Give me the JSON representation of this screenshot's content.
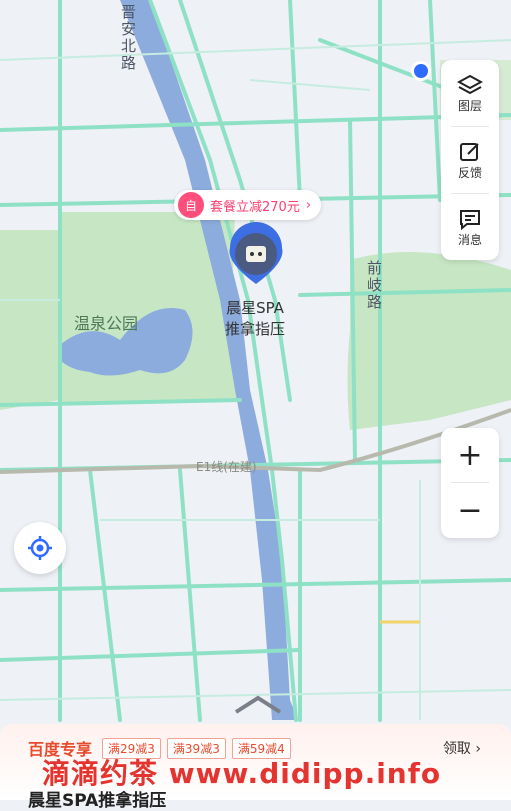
{
  "map": {
    "roads": {
      "jinan_north": "晋安北路",
      "qianqi": "前岐路",
      "metro": "E1线(在建)"
    },
    "park_label": "温泉公园",
    "poi": {
      "name_line1": "晨星SPA",
      "name_line2": "推拿指压"
    },
    "promo": {
      "icon_text": "自",
      "text": "套餐立减270元",
      "chevron": "›"
    },
    "colors": {
      "road": "#8fe1c5",
      "park": "#c7e7c4",
      "water": "#8cacdd",
      "promo": "#ff3d6e",
      "location_dot": "#2f6bff"
    }
  },
  "controls": {
    "layers_label": "图层",
    "feedback_label": "反馈",
    "message_label": "消息",
    "zoom_in": "+",
    "zoom_out": "−"
  },
  "bottom_sheet": {
    "title": "百度专享",
    "coupons": [
      "满29减3",
      "满39减3",
      "满59减4"
    ],
    "claim": "领取",
    "claim_chevron": "›",
    "shop_name": "晨星SPA推拿指压"
  },
  "watermark": "滴滴约茶 www.didipp.info"
}
